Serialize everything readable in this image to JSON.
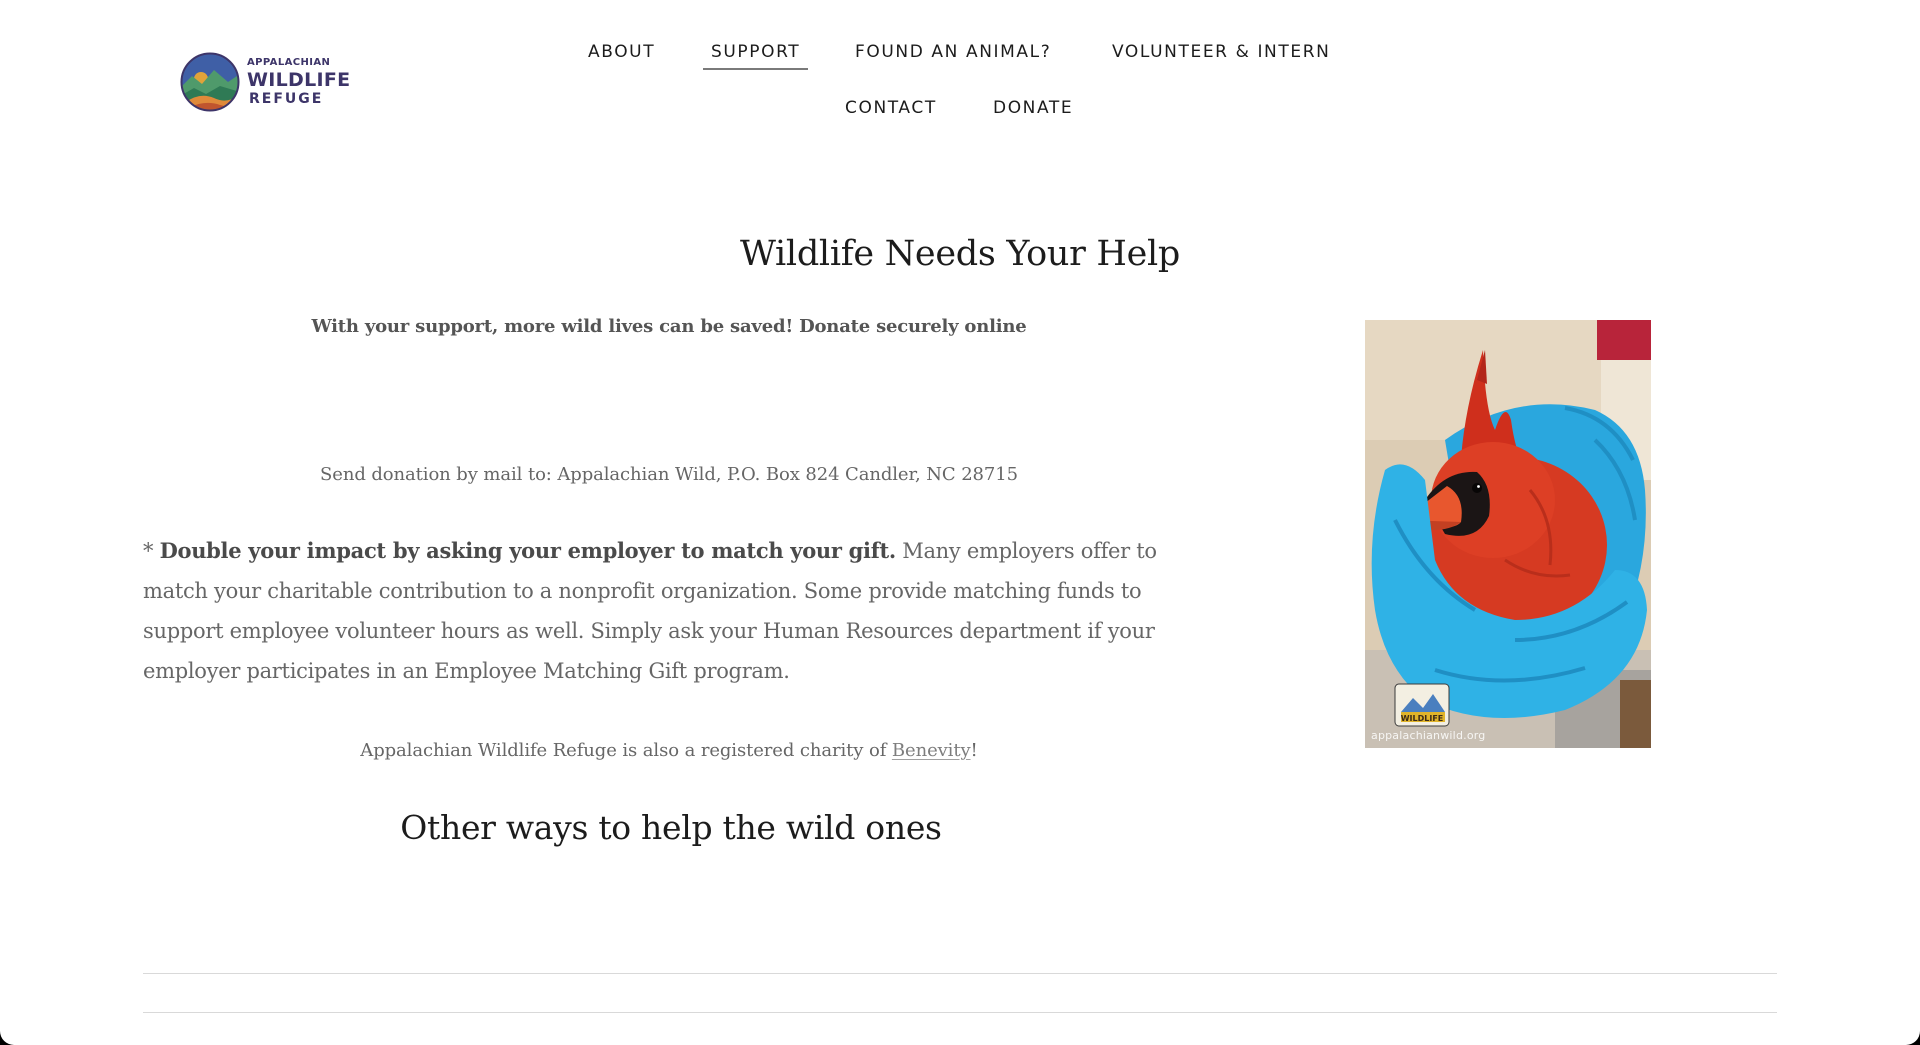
{
  "brand": {
    "logo_line1": "APPALACHIAN",
    "logo_line2": "WILDLIFE",
    "logo_line3": "REFUGE",
    "logo_colors": {
      "text": "#3d3569",
      "sky": "#3b4a8c",
      "mountain": "#4f9a6b",
      "sun": "#e0a33a"
    }
  },
  "nav": {
    "items": [
      {
        "label": "ABOUT"
      },
      {
        "label": "SUPPORT",
        "active": true
      },
      {
        "label": "FOUND AN ANIMAL?"
      },
      {
        "label": "VOLUNTEER & INTERN"
      },
      {
        "label": "CONTACT"
      },
      {
        "label": "DONATE"
      }
    ]
  },
  "main": {
    "title": "Wildlife Needs Your Help",
    "support_line": "With your support, more wild lives can be saved! Donate securely online",
    "mail_line": "Send donation by mail to: Appalachian Wild, P.O. Box 824 Candler, NC 28715",
    "match_prefix": "* ",
    "match_bold": "Double your impact by asking your employer to match your gift.",
    "match_rest": " Many employers offer to match your charitable contribution to a nonprofit organization. Some provide matching funds to support employee volunteer hours as well. Simply ask your Human Resources department if your employer participates in an Employee Matching Gift program.",
    "charity_before": "Appalachian Wildlife Refuge is also a registered charity of ",
    "charity_link": "Benevity",
    "charity_after": "!",
    "other_ways_heading": "Other ways to help the wild ones"
  },
  "photo": {
    "watermark_url": "appalachianwild.org",
    "watermark_badge_text": "WILDLIFE",
    "subject": "cardinal-in-gloved-hands"
  },
  "colors": {
    "heading": "#1c1c1c",
    "body_text": "#666666",
    "divider": "#d9d9d9",
    "glove": "#27a9e0",
    "cardinal": "#d9341f"
  }
}
